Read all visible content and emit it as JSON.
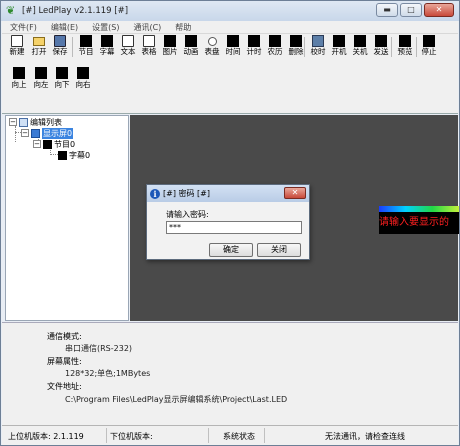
{
  "window": {
    "title": "[#] LedPlay  v2.1.119  [#]",
    "minimize": "▬",
    "maximize": "□",
    "close": "✕"
  },
  "menu": [
    "文件(F)",
    "编辑(E)",
    "设置(S)",
    "通讯(C)",
    "帮助"
  ],
  "toolbar": {
    "new": "新建",
    "open": "打开",
    "save": "保存",
    "program": "节目",
    "subtitle": "字幕",
    "text": "文本",
    "table": "表格",
    "image": "图片",
    "animation": "动画",
    "dial": "表盘",
    "time": "时间",
    "timer": "计时",
    "temperature": "农历",
    "delete": "删除",
    "sync_time": "校时",
    "power_on": "开机",
    "power_off": "关机",
    "send": "发送",
    "preview": "预览",
    "stop": "停止"
  },
  "toolbar2": {
    "up": "向上",
    "left": "向左",
    "down": "向下",
    "right": "向右"
  },
  "tree": {
    "root": "编辑列表",
    "screen": "显示屏0",
    "program": "节目0",
    "subtitle": "字幕0"
  },
  "canvas": {
    "led_text": "请输入要显示的"
  },
  "info": {
    "comm_mode_label": "通信模式:",
    "comm_mode_value": "串口通信(RS-232)",
    "screen_attr_label": "屏幕属性:",
    "screen_attr_value": "128*32;单色;1MBytes",
    "file_addr_label": "文件地址:",
    "file_addr_value": "C:\\Program Files\\LedPlay显示屏编辑系统\\Project\\Last.LED"
  },
  "statusbar": {
    "upper_version": "上位机版本:   2.1.119",
    "lower_version": "下位机版本:",
    "sys_status": "系统状态",
    "comm_status": "无法通讯，请检查连线"
  },
  "dialog": {
    "title": "[#] 密码 [#]",
    "prompt": "请输入密码:",
    "value": "***",
    "ok": "确定",
    "close": "关闭"
  }
}
